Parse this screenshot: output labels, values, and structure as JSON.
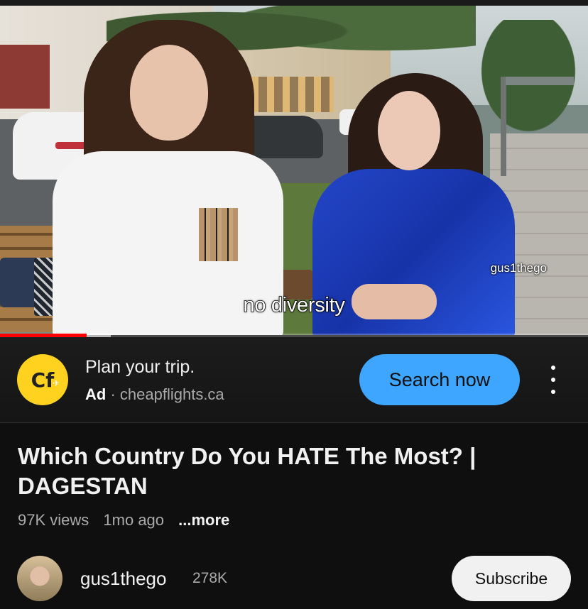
{
  "video": {
    "caption": "no diversity",
    "watermark": "gus1thego",
    "progress_fraction": 0.147,
    "buffered_fraction": 0.188
  },
  "ad": {
    "logo_text": "Cf",
    "title": "Plan your trip.",
    "badge": "Ad",
    "separator": "·",
    "domain": "cheapflights.ca",
    "cta_label": "Search now",
    "menu_icon": "kebab-menu-icon",
    "cta_color": "#3ea6ff",
    "logo_color": "#ffd21f"
  },
  "info": {
    "title": "Which Country Do You HATE The Most? | DAGESTAN",
    "views": "97K views",
    "age": "1mo ago",
    "more": "...more"
  },
  "channel": {
    "name": "gus1thego",
    "subscribers": "278K",
    "subscribe_label": "Subscribe"
  },
  "colors": {
    "background": "#0f0f0f",
    "progress": "#ff0000"
  }
}
